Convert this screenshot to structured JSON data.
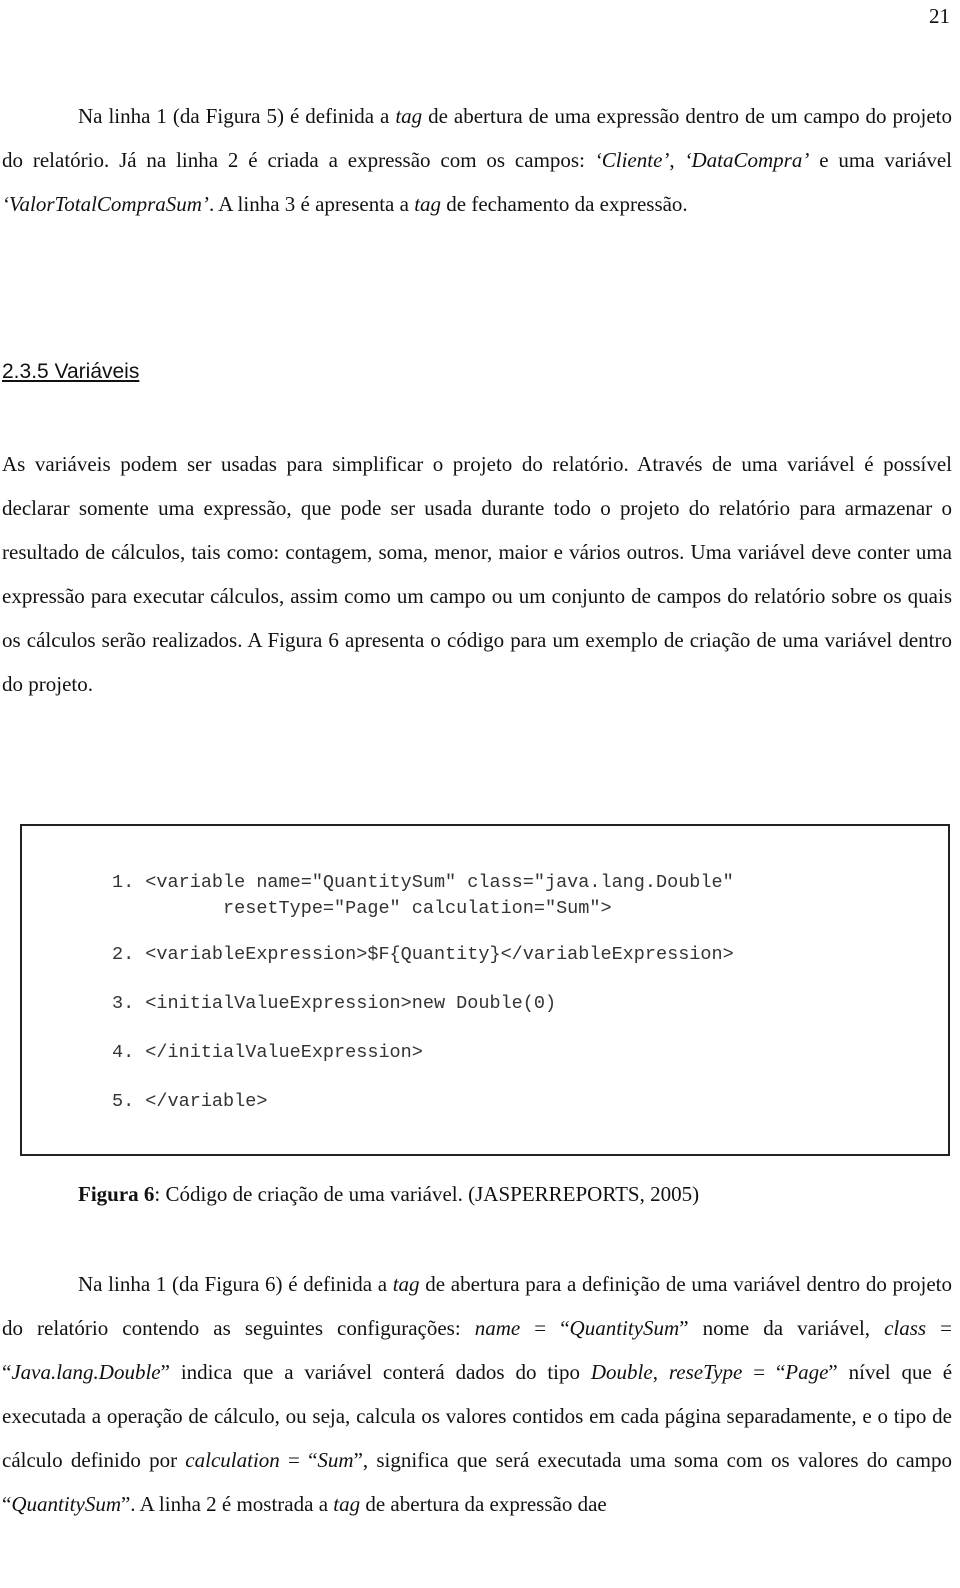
{
  "page_number": "21",
  "para1": {
    "s1": "Na linha 1 (da Figura 5) é definida a ",
    "tag1": "tag",
    "s2": " de abertura de  uma expressão dentro de um campo do projeto do relatório. Já na linha 2 é criada a expressão com os campos: ",
    "f1": "‘Cliente’",
    "s3": ", ",
    "f2": "‘DataCompra’",
    "s4": " e uma variável ",
    "f3": "‘ValorTotalCompraSum’",
    "s5": ". A linha 3 é apresenta a ",
    "tag2": "tag",
    "s6": " de fechamento da expressão."
  },
  "heading": "2.3.5 Variáveis",
  "para2": "As variáveis podem ser usadas para simplificar o projeto do relatório. Através de uma variável é possível declarar somente uma expressão, que pode ser usada durante todo o projeto do relatório para armazenar o resultado de cálculos, tais como: contagem, soma, menor, maior e vários outros. Uma variável deve conter uma expressão para executar cálculos, assim como um campo ou um conjunto de campos do relatório sobre os quais os cálculos serão realizados. A Figura 6 apresenta o código para um exemplo de criação de uma variável dentro do projeto.",
  "code_lines": [
    "1. <variable name=\"QuantitySum\" class=\"java.lang.Double\"",
    "          resetType=\"Page\" calculation=\"Sum\">",
    "2. <variableExpression>$F{Quantity}</variableExpression>",
    "3. <initialValueExpression>new Double(0)",
    "4. </initialValueExpression>",
    "5. </variable>"
  ],
  "caption": {
    "label": "Figura 6",
    "text": ": Código de criação de uma variável. (JASPERREPORTS, 2005)"
  },
  "para3": {
    "s1": "Na linha 1 (da Figura 6) é definida a ",
    "i1": "tag",
    "s2": " de abertura para a definição de uma variável dentro do projeto do relatório contendo as seguintes configurações: ",
    "i2": "name",
    "s3": " = “",
    "i3": "QuantitySum",
    "s4": "” nome da variável, ",
    "i4": "class",
    "s5": " = “",
    "i5": "Java.lang.Double",
    "s6": "” indica que a variável conterá dados do tipo ",
    "i6": "Double",
    "s7": ", ",
    "i7": "reseType",
    "s8": " = “",
    "i8": "Page",
    "s9": "” nível que é executada a operação de cálculo, ou seja, calcula os valores contidos em cada página separadamente, e o tipo de cálculo definido por ",
    "i9": "calculation",
    "s10": " = “",
    "i10": "Sum",
    "s11": "”, significa que será executada uma soma com os valores do campo “",
    "i11": "QuantitySum",
    "s12": "”. A linha 2 é mostrada a ",
    "i12": "tag",
    "s13": " de abertura da expressão dae"
  }
}
